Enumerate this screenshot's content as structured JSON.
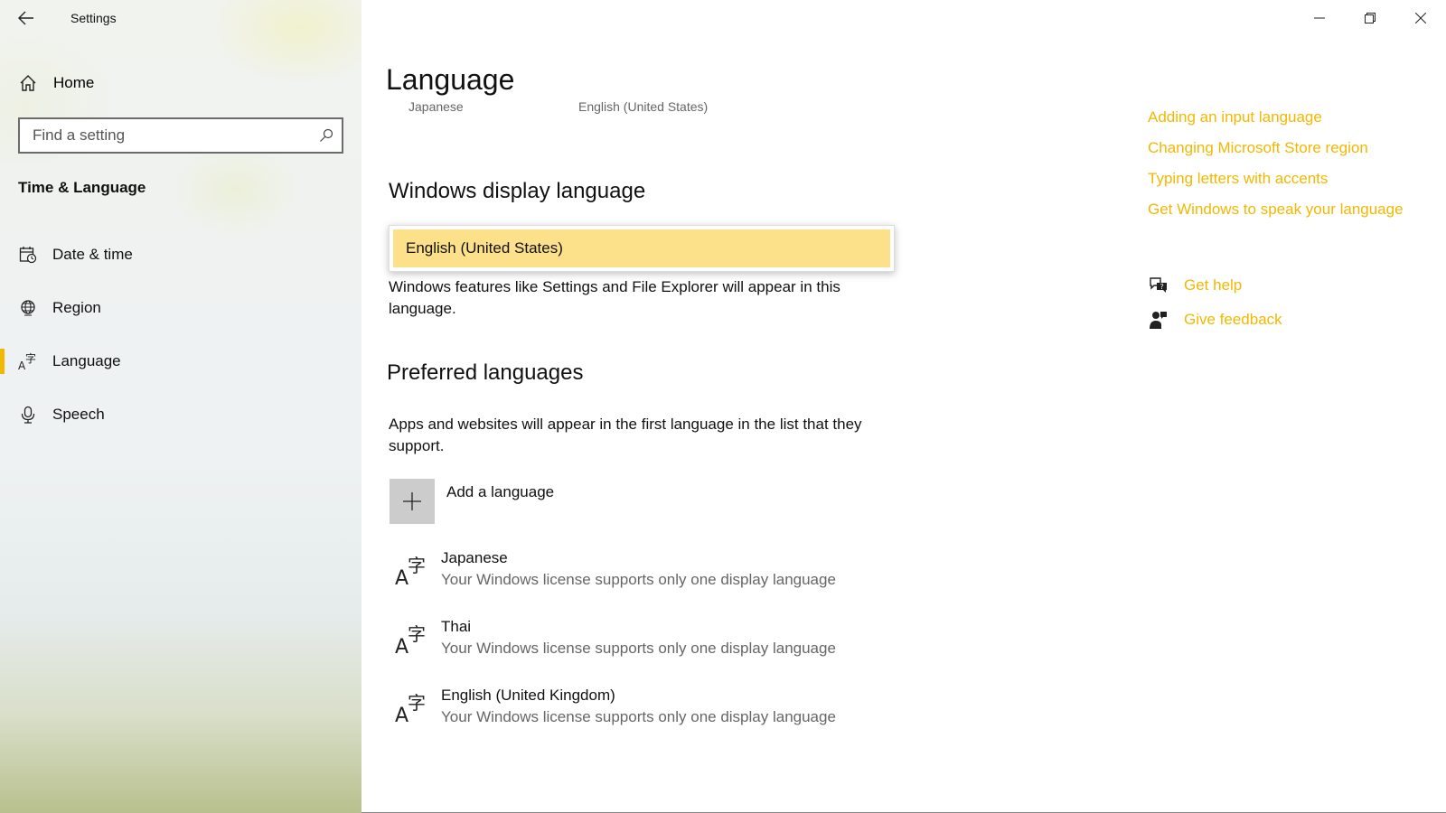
{
  "app": {
    "title": "Settings"
  },
  "sidebar": {
    "home_label": "Home",
    "search_placeholder": "Find a setting",
    "section_title": "Time & Language",
    "items": [
      {
        "label": "Date & time",
        "icon": "calendar-clock-icon"
      },
      {
        "label": "Region",
        "icon": "globe-icon"
      },
      {
        "label": "Language",
        "icon": "language-icon",
        "active": true
      },
      {
        "label": "Speech",
        "icon": "microphone-icon"
      }
    ]
  },
  "main": {
    "title": "Language",
    "cut_row": {
      "left": "Japanese",
      "right": "English (United States)"
    },
    "display_language": {
      "heading": "Windows display language",
      "selected": "English (United States)",
      "description": "Windows features like Settings and File Explorer will appear in this language."
    },
    "preferred": {
      "heading": "Preferred languages",
      "description": "Apps and websites will appear in the first language in the list that they support.",
      "add_label": "Add a language",
      "languages": [
        {
          "name": "Japanese",
          "note": "Your Windows license supports only one display language"
        },
        {
          "name": "Thai",
          "note": "Your Windows license supports only one display language"
        },
        {
          "name": "English (United Kingdom)",
          "note": "Your Windows license supports only one display language"
        }
      ]
    }
  },
  "related_links": [
    "Adding an input language",
    "Changing Microsoft Store region",
    "Typing letters with accents",
    "Get Windows to speak your language"
  ],
  "help": {
    "get_help": "Get help",
    "give_feedback": "Give feedback"
  },
  "colors": {
    "accent": "#f2b800",
    "highlight": "#fde08a"
  }
}
